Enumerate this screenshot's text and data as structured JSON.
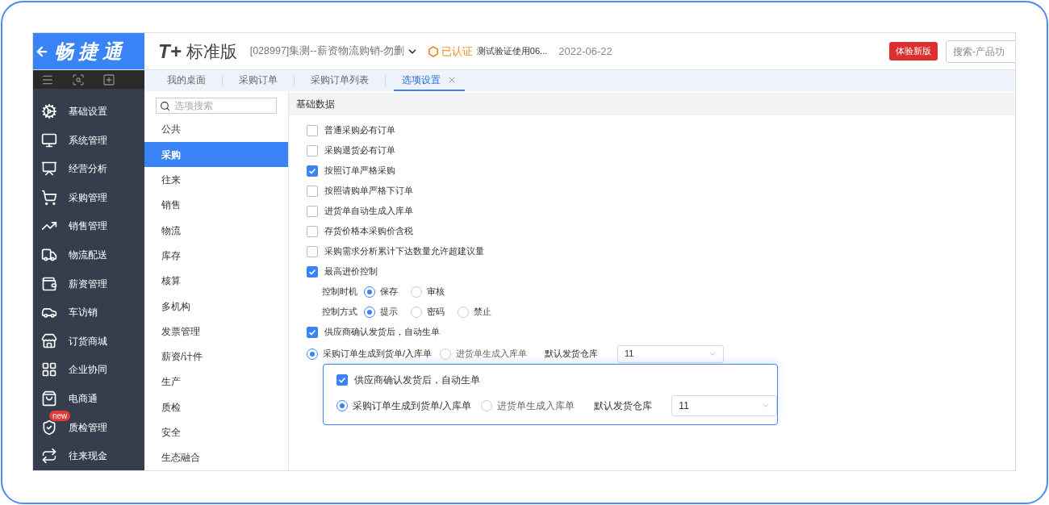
{
  "brand": {
    "logo_text": "畅捷通",
    "product_mark": "T+",
    "product_name": "标准版"
  },
  "header": {
    "company": "[028997]集测--薪资物流购销-勿删",
    "certified": "已认证",
    "cert_note": "测试验证使用06...",
    "date": "2022-06-22",
    "trial_button": "体验新版",
    "search_placeholder": "搜索-产品功"
  },
  "sidebar": {
    "items": [
      {
        "label": "基础设置"
      },
      {
        "label": "系统管理"
      },
      {
        "label": "经营分析"
      },
      {
        "label": "采购管理"
      },
      {
        "label": "销售管理"
      },
      {
        "label": "物流配送"
      },
      {
        "label": "薪资管理"
      },
      {
        "label": "车访销"
      },
      {
        "label": "订货商城"
      },
      {
        "label": "企业协同"
      },
      {
        "label": "电商通"
      },
      {
        "label": "质检管理",
        "badge": "new"
      },
      {
        "label": "往来现金"
      }
    ]
  },
  "tabs": [
    {
      "label": "我的桌面",
      "selected": false,
      "closable": false
    },
    {
      "label": "采购订单",
      "selected": false,
      "closable": false
    },
    {
      "label": "采购订单列表",
      "selected": false,
      "closable": false
    },
    {
      "label": "选项设置",
      "selected": true,
      "closable": true
    }
  ],
  "option_search": {
    "placeholder": "选项搜索"
  },
  "categories": [
    {
      "label": "公共",
      "selected": false
    },
    {
      "label": "采购",
      "selected": true
    },
    {
      "label": "往来",
      "selected": false
    },
    {
      "label": "销售",
      "selected": false
    },
    {
      "label": "物流",
      "selected": false
    },
    {
      "label": "库存",
      "selected": false
    },
    {
      "label": "核算",
      "selected": false
    },
    {
      "label": "多机构",
      "selected": false
    },
    {
      "label": "发票管理",
      "selected": false
    },
    {
      "label": "薪资/计件",
      "selected": false
    },
    {
      "label": "生产",
      "selected": false
    },
    {
      "label": "质检",
      "selected": false
    },
    {
      "label": "安全",
      "selected": false
    },
    {
      "label": "生态融合",
      "selected": false
    }
  ],
  "section_title": "基础数据",
  "options": [
    {
      "kind": "checkbox",
      "label": "普通采购必有订单",
      "checked": false
    },
    {
      "kind": "checkbox",
      "label": "采购退货必有订单",
      "checked": false
    },
    {
      "kind": "checkbox",
      "label": "按照订单严格采购",
      "checked": true
    },
    {
      "kind": "checkbox",
      "label": "按照请购单严格下订单",
      "checked": false
    },
    {
      "kind": "checkbox",
      "label": "进货单自动生成入库单",
      "checked": false
    },
    {
      "kind": "checkbox",
      "label": "存货价格本采购价含税",
      "checked": false
    },
    {
      "kind": "checkbox",
      "label": "采购需求分析累计下达数量允许超建议量",
      "checked": false
    },
    {
      "kind": "checkbox",
      "label": "最高进价控制",
      "checked": true
    },
    {
      "kind": "radio_group",
      "label": "控制时机",
      "choices": [
        {
          "label": "保存",
          "selected": true
        },
        {
          "label": "审核",
          "selected": false
        }
      ]
    },
    {
      "kind": "radio_group",
      "label": "控制方式",
      "choices": [
        {
          "label": "提示",
          "selected": true
        },
        {
          "label": "密码",
          "selected": false
        },
        {
          "label": "禁止",
          "selected": false
        }
      ]
    },
    {
      "kind": "checkbox",
      "label": "供应商确认发货后，自动生单",
      "checked": true
    },
    {
      "kind": "radio_select",
      "choices": [
        {
          "label": "采购订单生成到货单/入库单",
          "selected": true
        },
        {
          "label": "进货单生成入库单",
          "selected": false
        }
      ],
      "select_label": "默认发货仓库",
      "select_value": "11"
    }
  ],
  "callout": {
    "options": [
      {
        "kind": "checkbox",
        "label": "供应商确认发货后，自动生单",
        "checked": true
      },
      {
        "kind": "radio_select",
        "choices": [
          {
            "label": "采购订单生成到货单/入库单",
            "selected": true
          },
          {
            "label": "进货单生成入库单",
            "selected": false
          }
        ],
        "select_label": "默认发货仓库",
        "select_value": "11"
      }
    ]
  }
}
